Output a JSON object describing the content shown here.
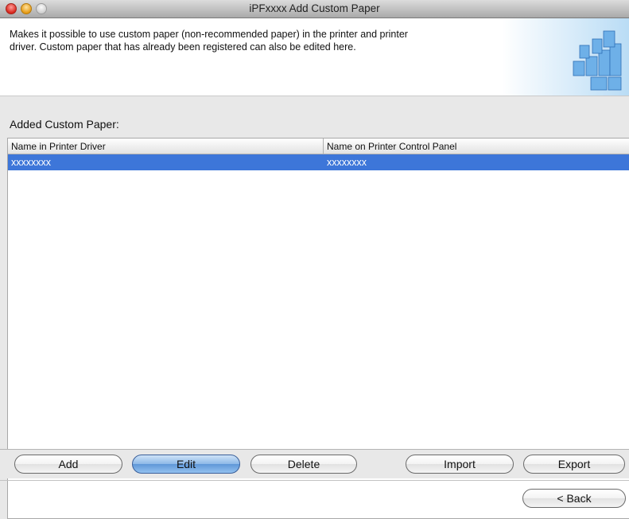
{
  "window": {
    "title": "iPFxxxx  Add Custom Paper"
  },
  "header": {
    "description_line1": "Makes it possible to use custom paper (non-recommended paper) in the printer and printer",
    "description_line2": "driver. Custom paper that has already been registered can also be edited here."
  },
  "list": {
    "label": "Added Custom Paper:",
    "columns": [
      "Name in Printer Driver",
      "Name on Printer Control Panel"
    ],
    "rows": [
      {
        "driver_name": "xxxxxxxx",
        "panel_name": "xxxxxxxx",
        "selected": true
      }
    ]
  },
  "buttons": {
    "add": "Add",
    "edit": "Edit",
    "delete": "Delete",
    "import": "Import",
    "export": "Export",
    "back": "< Back"
  },
  "colors": {
    "selection": "#3d76d9",
    "default_button": "#5f97d8"
  }
}
